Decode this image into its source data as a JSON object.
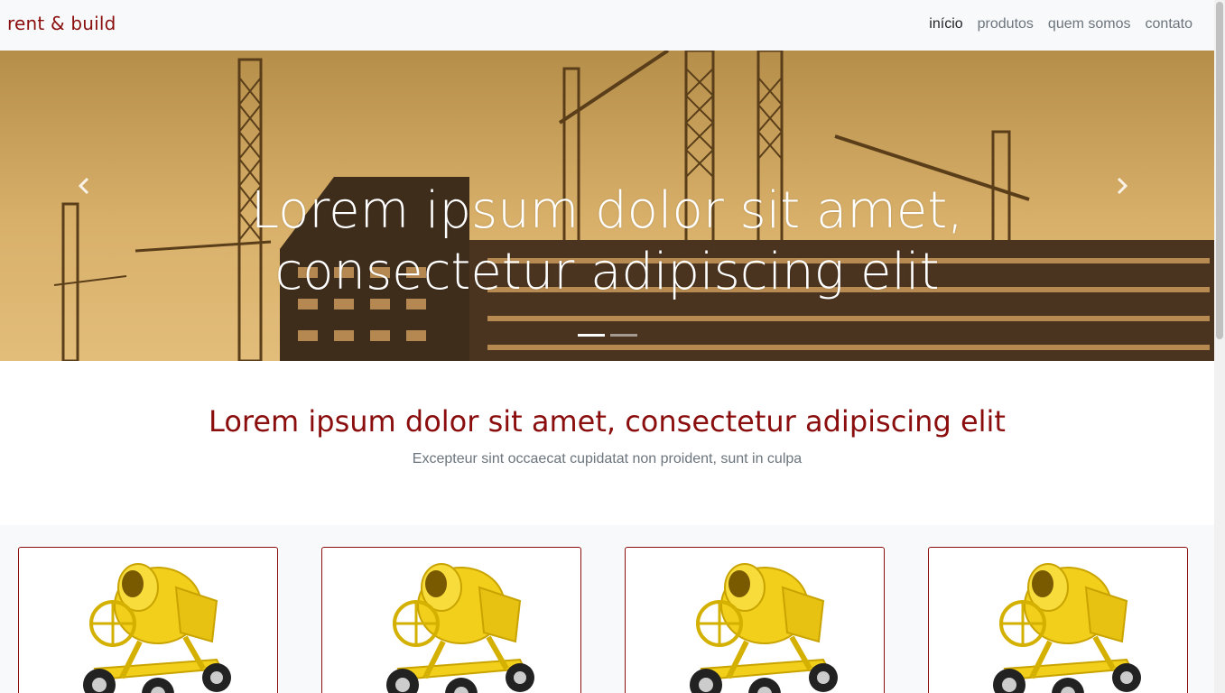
{
  "navbar": {
    "brand": "rent & build",
    "links": [
      "início",
      "produtos",
      "quem somos",
      "contato"
    ],
    "active_index": 0
  },
  "hero": {
    "caption_line1": "Lorem ipsum dolor sit amet,",
    "caption_line2": "consectetur adipiscing elit",
    "prev_icon": "chevron-left-icon",
    "next_icon": "chevron-right-icon",
    "slides": 2,
    "active_slide": 0
  },
  "intro": {
    "title": "Lorem ipsum dolor sit amet, consectetur adipiscing elit",
    "subtitle": "Excepteur sint occaecat cupidatat non proident, sunt in culpa"
  },
  "products": {
    "items": [
      {
        "image": "cement-mixer"
      },
      {
        "image": "cement-mixer"
      },
      {
        "image": "cement-mixer"
      },
      {
        "image": "cement-mixer"
      }
    ]
  },
  "colors": {
    "brand": "#8b0e0e",
    "navbar_bg": "#f8f9fa",
    "nav_text": "#6c757d",
    "nav_active": "#212529",
    "mixer_yellow": "#f2cf1a"
  }
}
